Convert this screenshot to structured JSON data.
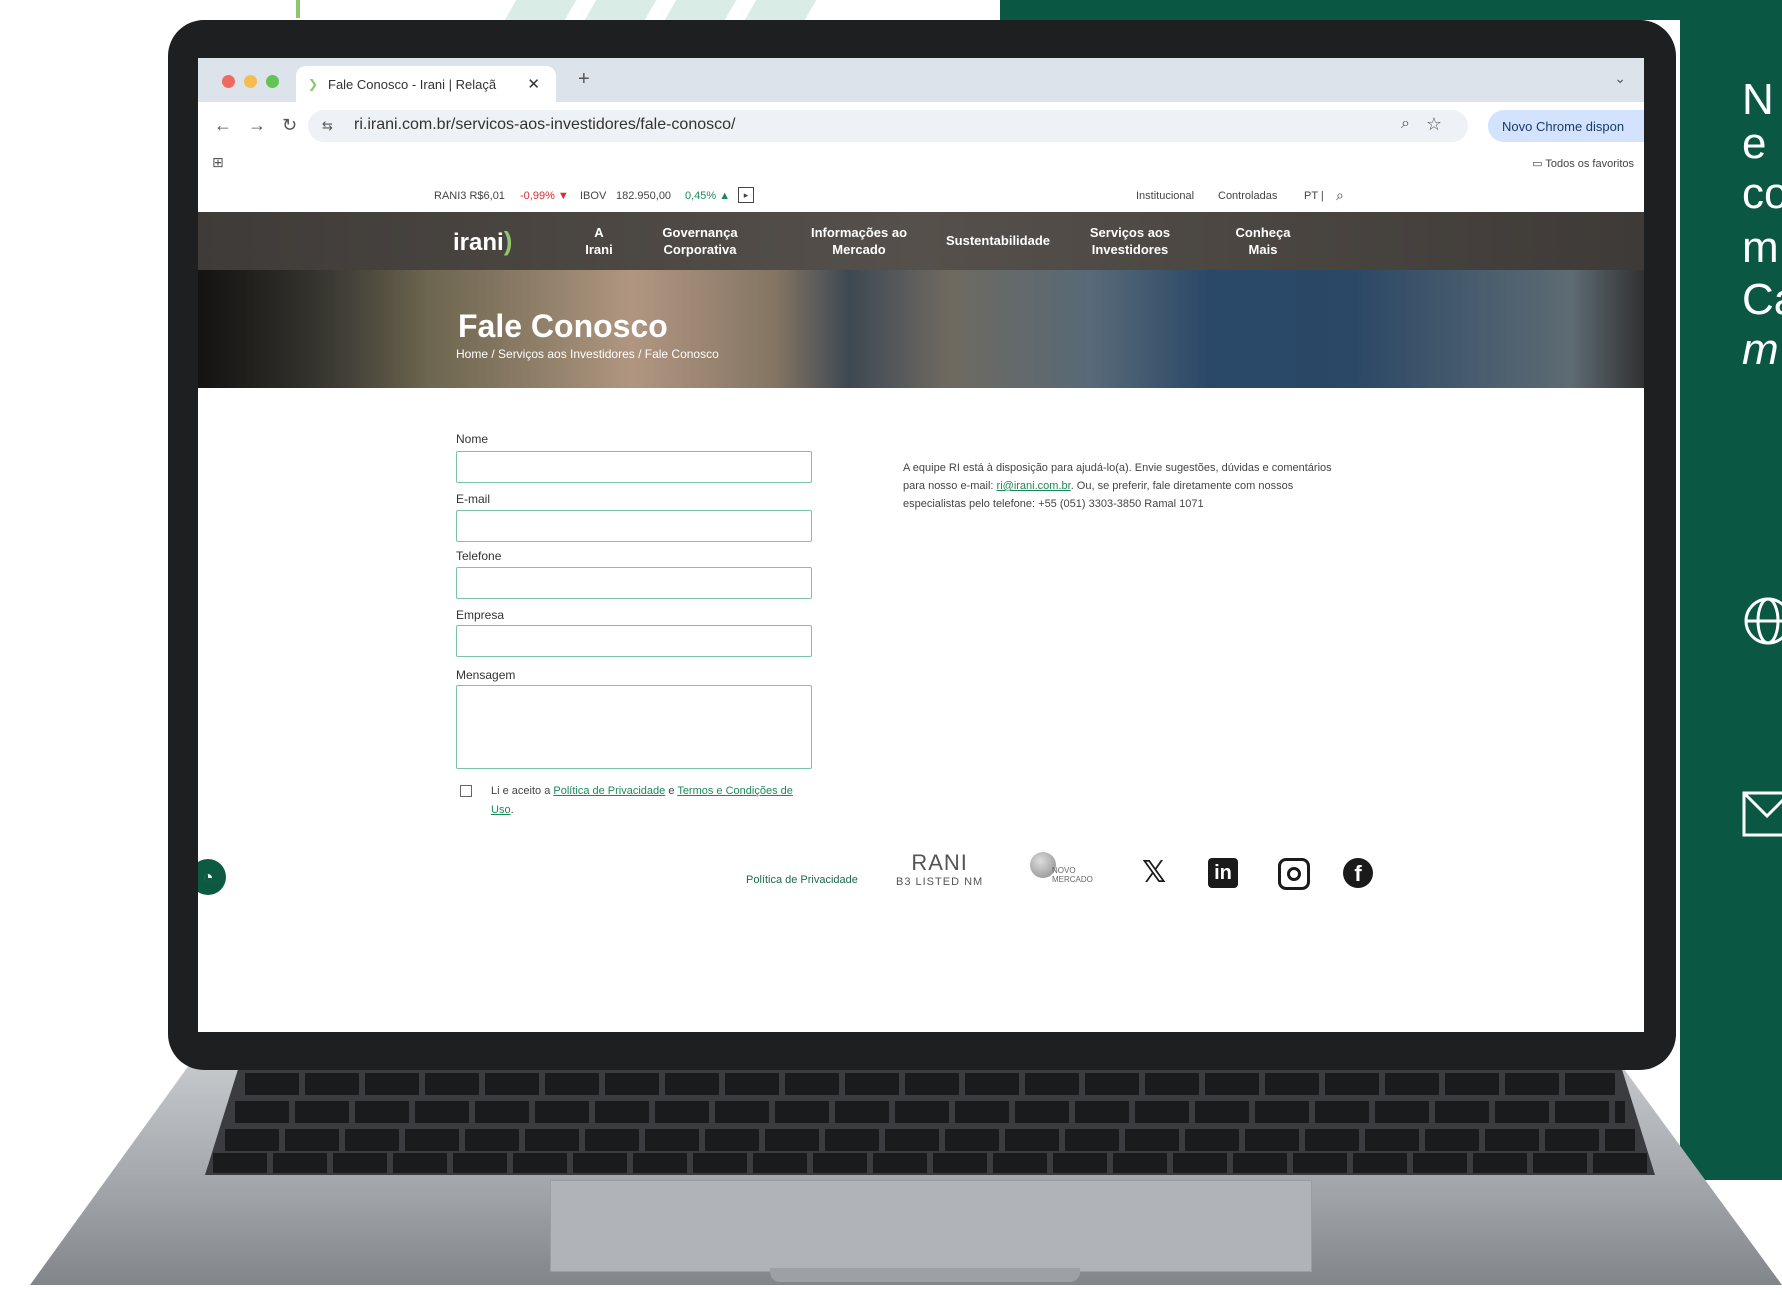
{
  "side": {
    "lines": [
      "N",
      "e",
      "co",
      "m",
      "Ca",
      "m"
    ],
    "globe_icon": "globe-icon",
    "mail_icon": "mail-icon"
  },
  "browser": {
    "tab_title": "Fale Conosco - Irani | Relaçã",
    "tab_close": "✕",
    "new_tab": "+",
    "tab_menu": "⌄",
    "back": "←",
    "forward": "→",
    "reload": "↻",
    "url": "ri.irani.com.br/servicos-aos-investidores/fale-conosco/",
    "chrome_update": "Novo Chrome dispon",
    "bookmarks_all": "Todos os favoritos"
  },
  "ticker": {
    "rani": "RANI3 R$6,01",
    "rani_change": "-0,99% ▼",
    "ibov": "IBOV",
    "ibov_value": "182.950,00",
    "ibov_change": "0,45% ▲",
    "institucional": "Institucional",
    "controladas": "Controladas",
    "lang": "PT |"
  },
  "nav": {
    "logo": "irani",
    "items": [
      {
        "line1": "A",
        "line2": "Irani"
      },
      {
        "line1": "Governança",
        "line2": "Corporativa"
      },
      {
        "line1": "Informações ao",
        "line2": "Mercado"
      },
      {
        "line1": "Sustentabilidade",
        "line2": ""
      },
      {
        "line1": "Serviços aos",
        "line2": "Investidores"
      },
      {
        "line1": "Conheça",
        "line2": "Mais"
      }
    ]
  },
  "hero": {
    "title": "Fale Conosco",
    "breadcrumb": "Home  /  Serviços aos Investidores  /  Fale Conosco"
  },
  "form": {
    "name_label": "Nome",
    "email_label": "E-mail",
    "phone_label": "Telefone",
    "company_label": "Empresa",
    "message_label": "Mensagem",
    "consent_prefix": "Li e aceito a ",
    "privacy_link": "Política de Privacidade",
    "consent_and": " e ",
    "terms_link": "Termos e Condições de Uso",
    "consent_suffix": "."
  },
  "info": {
    "text1": "A equipe RI está à disposição para ajudá-lo(a). Envie sugestões, dúvidas e comentários para nosso e-mail: ",
    "email": "ri@irani.com.br",
    "text2": ". Ou, se preferir, fale diretamente com nossos especialistas pelo telefone: +55 (051) 3303-3850 Ramal 1071"
  },
  "footer": {
    "privacy": "Política de Privacidade",
    "b3_line1": "RANI",
    "b3_line2": "B3 LISTED NM",
    "novo_mercado": "NOVO MERCADO",
    "x_icon": "𝕏",
    "linkedin": "in",
    "facebook": "f"
  }
}
